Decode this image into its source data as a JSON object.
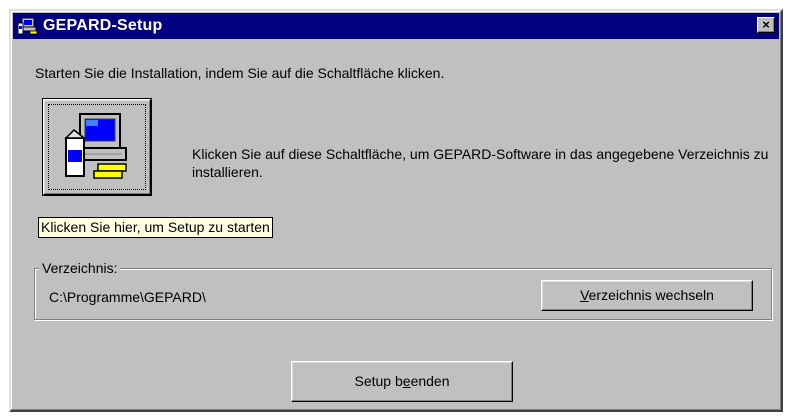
{
  "window": {
    "title": "GEPARD-Setup",
    "close_label": "×",
    "intro_text": "Starten Sie die Installation, indem Sie auf die Schaltfläche klicken.",
    "description": "Klicken Sie auf diese Schaltfläche, um GEPARD-Software in das angegebene Verzeichnis zu installieren.",
    "tooltip": "Klicken Sie hier, um Setup zu starten"
  },
  "directory": {
    "group_label": "Verzeichnis:",
    "path": "C:\\Programme\\GEPARD\\",
    "change_button": {
      "prefix": "",
      "accel": "V",
      "suffix": "erzeichnis wechseln"
    }
  },
  "exit_button": {
    "prefix": "Setup b",
    "accel": "e",
    "suffix": "enden"
  },
  "icons": {
    "title": "setup-computer-icon",
    "big_button": "setup-computer-icon",
    "close": "close-icon"
  },
  "colors": {
    "titlebar": "#000080",
    "face": "#c0c0c0",
    "tooltip_bg": "#ffffe1"
  }
}
